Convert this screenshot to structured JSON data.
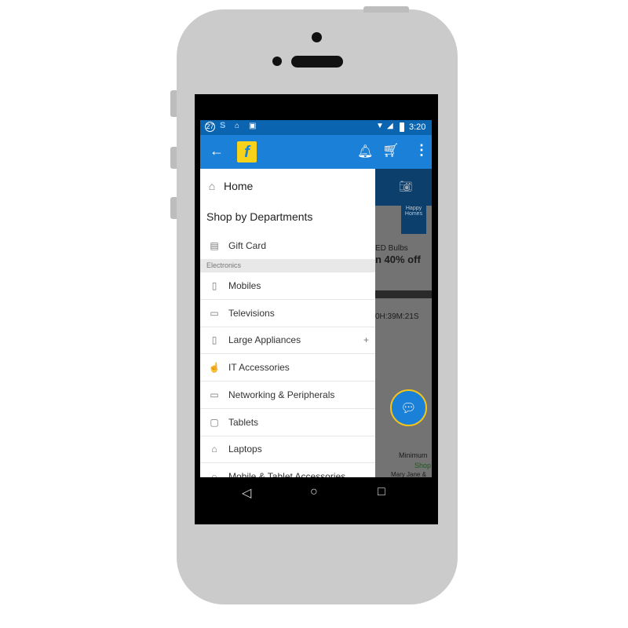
{
  "status": {
    "time": "3:20",
    "notif_badge": "27"
  },
  "drawer": {
    "home": "Home",
    "section_title": "Shop by Departments",
    "gift_card": "Gift Card",
    "group_label": "Electronics",
    "items": [
      {
        "label": "Mobiles",
        "icon": "mobile-icon"
      },
      {
        "label": "Televisions",
        "icon": "tv-icon"
      },
      {
        "label": "Large Appliances",
        "icon": "fridge-icon",
        "expand": "+"
      },
      {
        "label": "IT Accessories",
        "icon": "mouse-icon"
      },
      {
        "label": "Networking & Peripherals",
        "icon": "printer-icon"
      },
      {
        "label": "Tablets",
        "icon": "tablet-icon"
      },
      {
        "label": "Laptops",
        "icon": "laptop-icon"
      },
      {
        "label": "Mobile & Tablet Accessories",
        "icon": "headphones-icon"
      }
    ]
  },
  "background": {
    "banner_tag": "Happy Homes",
    "banner_line1": "ED Bulbs",
    "banner_line2": "n 40% off",
    "timer": "0H:39M:21S",
    "minimum": "Minimum",
    "shop": "Shop",
    "brand": "Mary Jane &"
  },
  "colors": {
    "primary": "#1a80d8",
    "status": "#0a64b0",
    "fab_border": "#f5c518"
  }
}
